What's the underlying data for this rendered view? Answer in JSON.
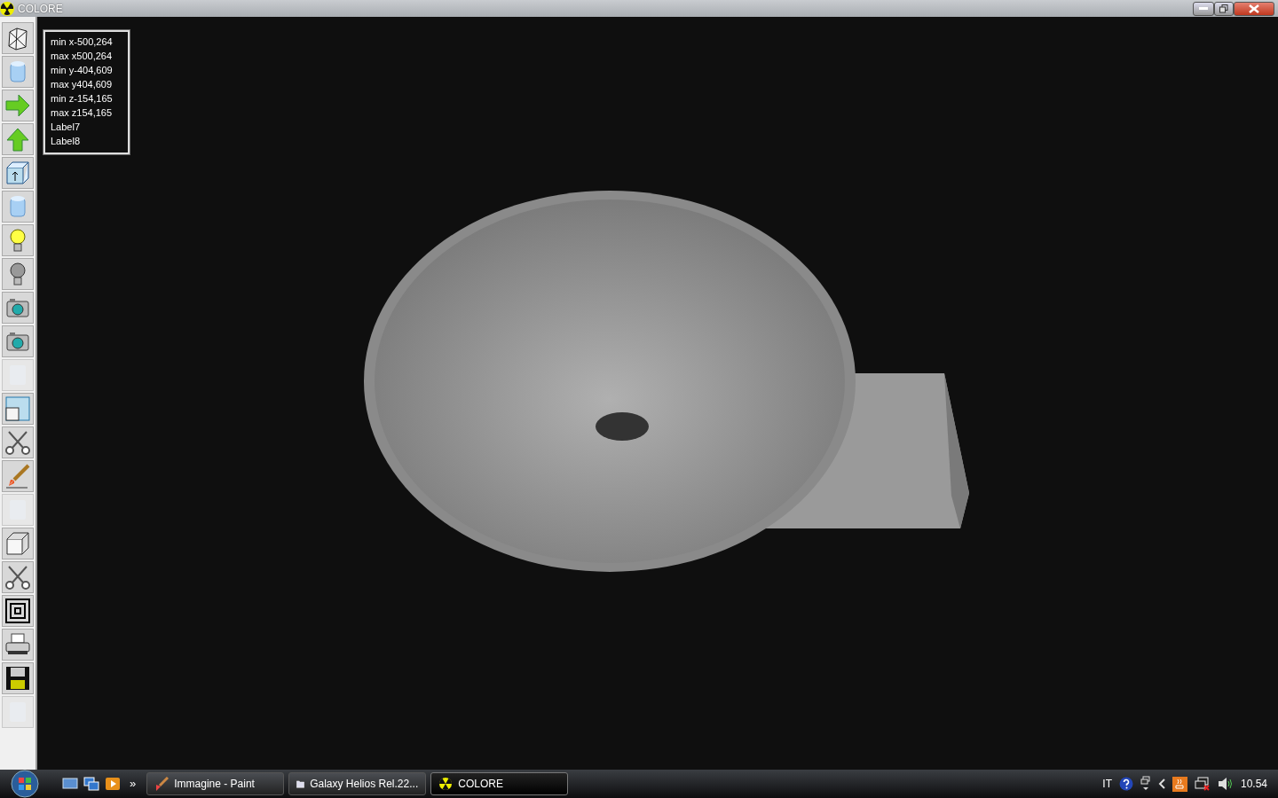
{
  "window": {
    "title": "COLORE"
  },
  "toolbar": [
    {
      "kind": "wireframe",
      "disabled": false
    },
    {
      "kind": "cylinder",
      "disabled": false
    },
    {
      "kind": "arrow-right",
      "disabled": false
    },
    {
      "kind": "arrow-up",
      "disabled": false
    },
    {
      "kind": "box-up",
      "disabled": false
    },
    {
      "kind": "cylinder",
      "disabled": false
    },
    {
      "kind": "bulb-on",
      "disabled": false
    },
    {
      "kind": "bulb-off",
      "disabled": false
    },
    {
      "kind": "camera",
      "disabled": false
    },
    {
      "kind": "camera",
      "disabled": false
    },
    {
      "kind": "blank",
      "disabled": true
    },
    {
      "kind": "window",
      "disabled": false
    },
    {
      "kind": "scissors",
      "disabled": false
    },
    {
      "kind": "brush",
      "disabled": false
    },
    {
      "kind": "blank",
      "disabled": true
    },
    {
      "kind": "cube",
      "disabled": false
    },
    {
      "kind": "scissors",
      "disabled": false
    },
    {
      "kind": "spiral",
      "disabled": false
    },
    {
      "kind": "printer",
      "disabled": false
    },
    {
      "kind": "floppy",
      "disabled": false
    },
    {
      "kind": "blank",
      "disabled": true
    }
  ],
  "info_labels": [
    "min x-500,264",
    "max x500,264",
    "min y-404,609",
    "max y404,609",
    "min z-154,165",
    "max z154,165",
    "Label7",
    "Label8"
  ],
  "taskbar": {
    "overflow": "»",
    "tasks": [
      {
        "label": "Immagine - Paint",
        "kind": "paint",
        "selected": false
      },
      {
        "label": "Galaxy Helios  Rel.22...",
        "kind": "folder",
        "selected": false
      },
      {
        "label": "COLORE",
        "kind": "radiation",
        "selected": true
      }
    ],
    "language": "IT",
    "clock": "10.54"
  }
}
